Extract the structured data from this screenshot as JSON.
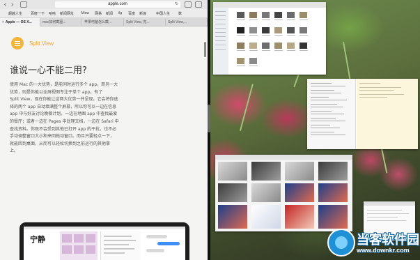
{
  "safari": {
    "url": "apple.com",
    "favorites": [
      "超越人生",
      "百度一下",
      "哈哈",
      "新闻网址",
      "iView",
      "网易",
      "新闻",
      "ilg",
      "百度",
      "新浪",
      "中国人生",
      "数"
    ],
    "tabs": [
      {
        "label": "Apple — OS X...",
        "active": true
      },
      {
        "label": "mac如何截图...",
        "active": false
      },
      {
        "label": "苹果电脑怎么截...",
        "active": false
      },
      {
        "label": "Split View, 完...",
        "active": false
      },
      {
        "label": "Split View,...",
        "active": false
      }
    ],
    "brand": "Split View",
    "heading": "谁说一心不能二用?",
    "paragraph_lines": [
      "使用 Mac 的一大优势，是能同时运行多个 app，而另一大",
      "优势，则是你能以全屏视图专注于单个 app。有了",
      "Split View，现在你能让这两大优势一并呈现。它会将你选",
      "择的两个 app 自动填满整个屏幕，所以你可以一边在信息",
      "app 中与好友讨论晚餐计划，一边在地图 app 中查找最爱",
      "的餐厅；或者一边在 Pages 中处理文档，一边在 Safari 中",
      "查找资料。你既不会受到其他已打开 app 的干扰，也不必",
      "手动调整窗口大小和来回拖动窗口。而且只要轻点一下，",
      "就能回到桌面，从而可以轻松切换到之前运行的其他事",
      "上。"
    ],
    "laptop_text": "宁静"
  },
  "watermark": {
    "brand": "当客软件园",
    "url": "www.downkr.com"
  },
  "colors": {
    "brand_orange": "#f2b73a",
    "watermark_blue": "#1f8fd6"
  }
}
